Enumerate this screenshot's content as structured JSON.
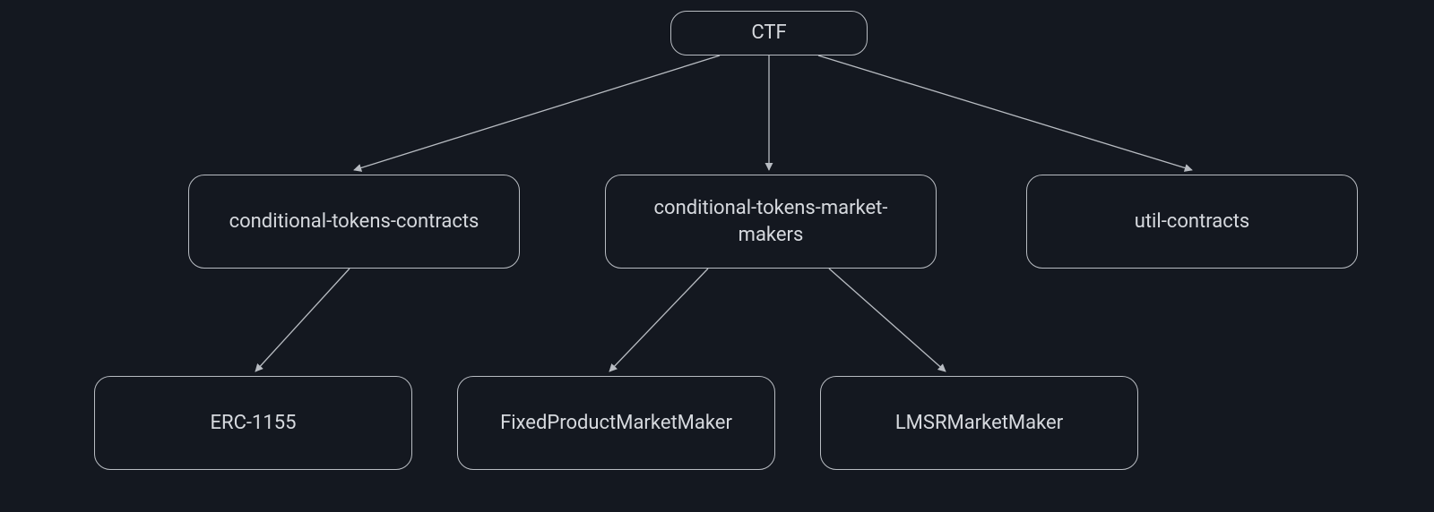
{
  "chart_data": {
    "type": "tree",
    "title": "",
    "nodes": [
      {
        "id": "ctf",
        "label": "CTF",
        "level": 0
      },
      {
        "id": "ctc",
        "label": "conditional-tokens-contracts",
        "level": 1,
        "parent": "ctf"
      },
      {
        "id": "ctmm",
        "label": "conditional-tokens-market-makers",
        "level": 1,
        "parent": "ctf"
      },
      {
        "id": "util",
        "label": "util-contracts",
        "level": 1,
        "parent": "ctf"
      },
      {
        "id": "erc",
        "label": "ERC-1155",
        "level": 2,
        "parent": "ctc"
      },
      {
        "id": "fpmm",
        "label": "FixedProductMarketMaker",
        "level": 2,
        "parent": "ctmm"
      },
      {
        "id": "lmsr",
        "label": "LMSRMarketMaker",
        "level": 2,
        "parent": "ctmm"
      }
    ],
    "edges": [
      {
        "from": "ctf",
        "to": "ctc"
      },
      {
        "from": "ctf",
        "to": "ctmm"
      },
      {
        "from": "ctf",
        "to": "util"
      },
      {
        "from": "ctc",
        "to": "erc"
      },
      {
        "from": "ctmm",
        "to": "fpmm"
      },
      {
        "from": "ctmm",
        "to": "lmsr"
      }
    ]
  },
  "nodes": {
    "ctf": {
      "label": "CTF"
    },
    "ctc": {
      "label": "conditional-tokens-contracts"
    },
    "ctmm": {
      "label": "conditional-tokens-market-makers"
    },
    "util": {
      "label": "util-contracts"
    },
    "erc": {
      "label": "ERC-1155"
    },
    "fpmm": {
      "label": "FixedProductMarketMaker"
    },
    "lmsr": {
      "label": "LMSRMarketMaker"
    }
  }
}
